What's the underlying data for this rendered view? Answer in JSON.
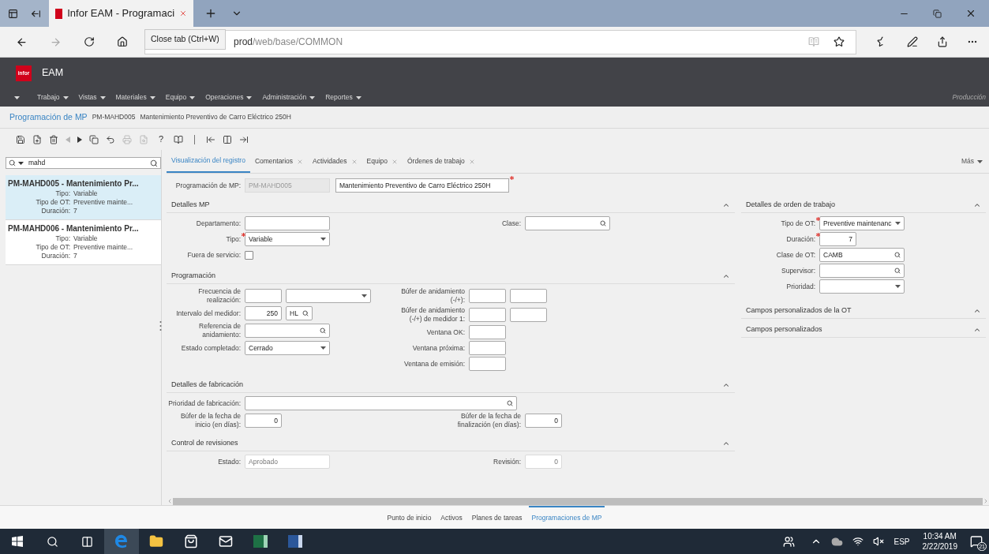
{
  "browser": {
    "tab_title": "Infor EAM - Programaci",
    "tooltip": "Close tab (Ctrl+W)",
    "address": {
      "host": "prod",
      "path": "/web/base/COMMON"
    }
  },
  "header": {
    "logo": "infor",
    "product": "EAM",
    "environment": "Producción",
    "menu": [
      {
        "label": "Trabajo"
      },
      {
        "label": "Vistas"
      },
      {
        "label": "Materiales"
      },
      {
        "label": "Equipo"
      },
      {
        "label": "Operaciones"
      },
      {
        "label": "Administración"
      },
      {
        "label": "Reportes"
      }
    ]
  },
  "breadcrumb": {
    "title": "Programación de MP",
    "code": "PM-MAHD005",
    "description": "Mantenimiento Preventivo de Carro Eléctrico 250H"
  },
  "toolbar": [
    {
      "disabled": false
    },
    {
      "disabled": false
    },
    {
      "disabled": false
    },
    {
      "disabled": true
    },
    {
      "disabled": false
    },
    {
      "disabled": false
    },
    {
      "disabled": false
    },
    {
      "disabled": true
    },
    {
      "disabled": true
    },
    {
      "glyph": "?",
      "disabled": false
    },
    {
      "disabled": false
    },
    {
      "disabled": false
    },
    {
      "disabled": false
    },
    {
      "disabled": false
    }
  ],
  "search": {
    "value": "mahd"
  },
  "results": [
    {
      "title": "PM-MAHD005 - Mantenimiento Pr...",
      "selected": true,
      "fields": [
        {
          "label": "Tipo:",
          "value": "Variable"
        },
        {
          "label": "Tipo de OT:",
          "value": "Preventive mainte..."
        },
        {
          "label": "Duración:",
          "value": "7"
        }
      ]
    },
    {
      "title": "PM-MAHD006 - Mantenimiento Pr...",
      "selected": false,
      "fields": [
        {
          "label": "Tipo:",
          "value": "Variable"
        },
        {
          "label": "Tipo de OT:",
          "value": "Preventive mainte..."
        },
        {
          "label": "Duración:",
          "value": "7"
        }
      ]
    }
  ],
  "tabs": [
    {
      "label": "Visualización del registro",
      "selected": true,
      "closable": false
    },
    {
      "label": "Comentarios",
      "selected": false,
      "closable": true
    },
    {
      "label": "Actividades",
      "selected": false,
      "closable": true
    },
    {
      "label": "Equipo",
      "selected": false,
      "closable": true
    },
    {
      "label": "Órdenes de trabajo",
      "selected": false,
      "closable": true
    }
  ],
  "more": "Más",
  "record": {
    "label": "Programación de MP:",
    "code": "PM-MAHD005",
    "description": "Mantenimiento Preventivo de Carro Eléctrico 250H",
    "required": true
  },
  "sections": [
    {
      "title": "Detalles MP",
      "expanded": true,
      "rows": [
        [
          {
            "label": "Departamento:",
            "required": false,
            "inputs": [
              {
                "kind": "text"
              }
            ]
          },
          {
            "label": "Clase:",
            "required": false,
            "inputs": [
              {
                "kind": "lookup"
              }
            ]
          }
        ],
        [
          {
            "label": "Tipo:",
            "required": true,
            "inputs": [
              {
                "kind": "select",
                "value": "Variable"
              }
            ]
          }
        ],
        [
          {
            "label": "Fuera de servicio:",
            "required": false,
            "inputs": [
              {
                "kind": "checkbox",
                "checked": false
              }
            ]
          }
        ]
      ]
    },
    {
      "title": "Programación",
      "expanded": true,
      "columns": [
        [
          {
            "label": "Frecuencia de realización:",
            "required": false,
            "inputs": [
              {
                "kind": "small"
              },
              {
                "kind": "select"
              }
            ]
          },
          {
            "label": "Intervalo del medidor:",
            "required": false,
            "inputs": [
              {
                "kind": "number",
                "value": "250"
              },
              {
                "kind": "lookupsmall",
                "value": "HL"
              }
            ]
          },
          {
            "label": "Referencia de anidamiento:",
            "required": false,
            "inputs": [
              {
                "kind": "lookup"
              }
            ]
          },
          {
            "label": "Estado completado:",
            "required": false,
            "inputs": [
              {
                "kind": "select",
                "value": "Cerrado"
              }
            ]
          }
        ],
        [
          {
            "label": "Búfer de anidamiento (-/+):",
            "required": false,
            "inputs": [
              {
                "kind": "small"
              },
              {
                "kind": "small"
              }
            ]
          },
          {
            "label": "Búfer de anidamiento (-/+) de medidor 1:",
            "required": false,
            "inputs": [
              {
                "kind": "small"
              },
              {
                "kind": "small"
              }
            ]
          },
          {
            "label": "Ventana OK:",
            "required": false,
            "inputs": [
              {
                "kind": "small"
              }
            ]
          },
          {
            "label": "Ventana próxima:",
            "required": false,
            "inputs": [
              {
                "kind": "small"
              }
            ]
          },
          {
            "label": "Ventana de emisión:",
            "required": false,
            "inputs": [
              {
                "kind": "small"
              }
            ]
          }
        ]
      ]
    },
    {
      "title": "Detalles de fabricación",
      "expanded": true,
      "rows": [
        [
          {
            "label": "Prioridad de fabricación:",
            "required": false,
            "inputs": [
              {
                "kind": "lookupwide"
              }
            ]
          }
        ],
        [
          {
            "label": "Búfer de la fecha de inicio (en días):",
            "required": false,
            "inputs": [
              {
                "kind": "number",
                "value": "0"
              }
            ]
          },
          {
            "label": "Búfer de la fecha de finalización (en días):",
            "required": false,
            "inputs": [
              {
                "kind": "number",
                "value": "0"
              }
            ]
          }
        ]
      ]
    },
    {
      "title": "Control de revisiones",
      "expanded": true,
      "rows": [
        [
          {
            "label": "Estado:",
            "required": false,
            "inputs": [
              {
                "kind": "readonly",
                "value": "Aprobado"
              }
            ]
          },
          {
            "label": "Revisión:",
            "required": false,
            "inputs": [
              {
                "kind": "readonlysmall",
                "value": "0"
              }
            ]
          }
        ]
      ]
    }
  ],
  "side_sections": [
    {
      "title": "Detalles de orden de trabajo",
      "expanded": true,
      "rows": [
        [
          {
            "label": "Tipo de OT:",
            "required": true,
            "inputs": [
              {
                "kind": "select",
                "value": "Preventive maintenanc"
              }
            ]
          }
        ],
        [
          {
            "label": "Duración:",
            "required": true,
            "inputs": [
              {
                "kind": "number",
                "value": "7"
              }
            ]
          }
        ],
        [
          {
            "label": "Clase de OT:",
            "required": false,
            "inputs": [
              {
                "kind": "lookup",
                "value": "CAMB"
              }
            ]
          }
        ],
        [
          {
            "label": "Supervisor:",
            "required": false,
            "inputs": [
              {
                "kind": "lookup"
              }
            ]
          }
        ],
        [
          {
            "label": "Prioridad:",
            "required": false,
            "inputs": [
              {
                "kind": "select"
              }
            ]
          }
        ]
      ]
    },
    {
      "title": "Campos personalizados de la OT",
      "expanded": true
    },
    {
      "title": "Campos personalizados",
      "expanded": true
    }
  ],
  "bottom_nav": [
    {
      "label": "Punto de inicio",
      "selected": false
    },
    {
      "label": "Activos",
      "selected": false
    },
    {
      "label": "Planes de tareas",
      "selected": false
    },
    {
      "label": "Programaciones de MP",
      "selected": true
    }
  ],
  "taskbar": {
    "language": "ESP",
    "time": "10:34 AM",
    "date": "2/22/2019",
    "notifications": "21"
  }
}
